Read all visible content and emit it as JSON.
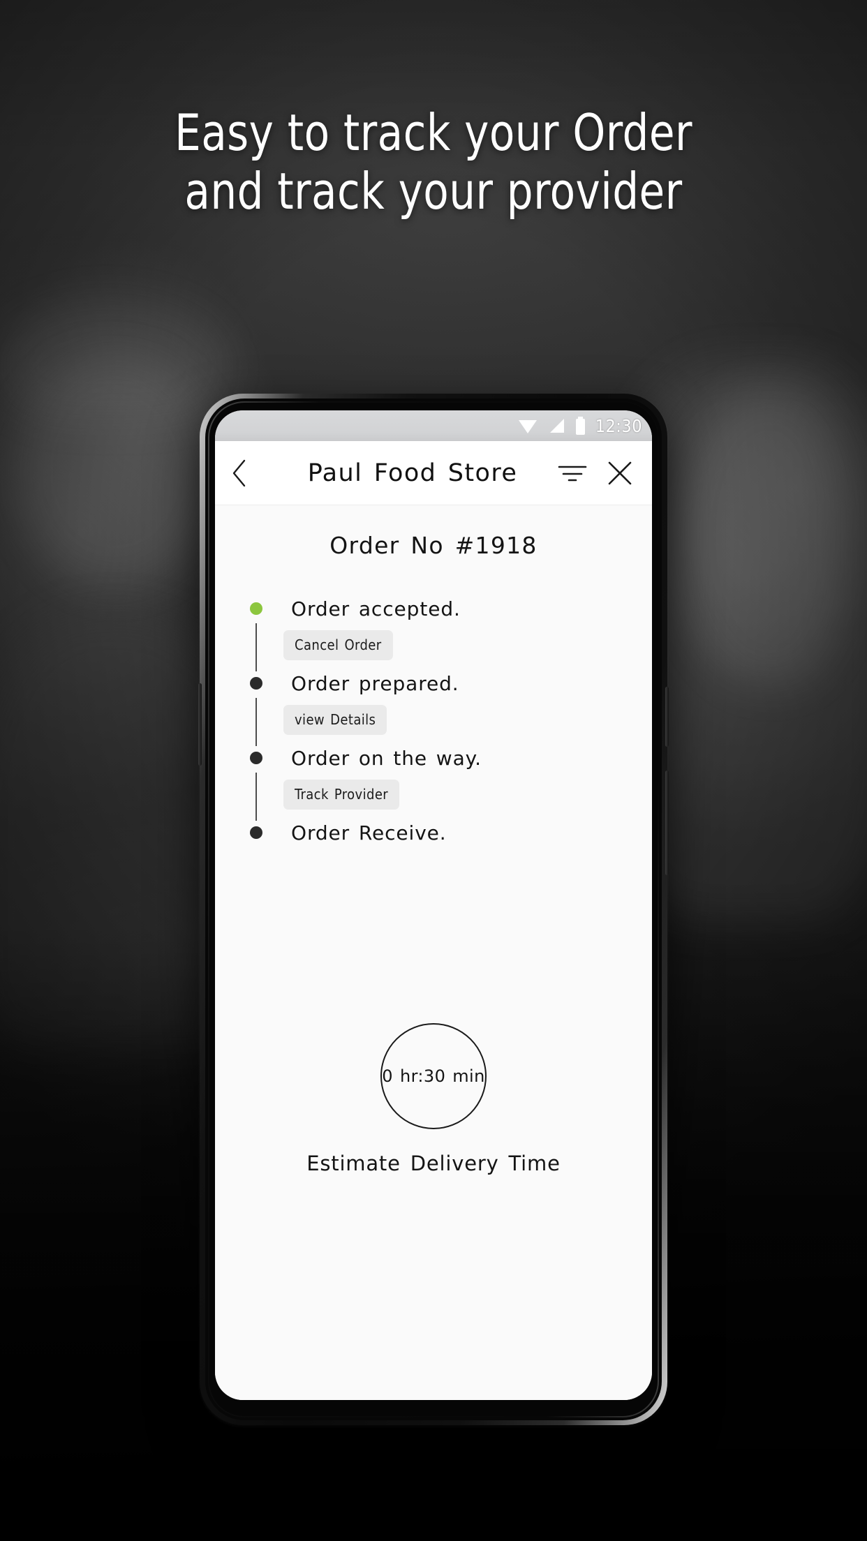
{
  "promo": {
    "headline_line1": "Easy to track your Order",
    "headline_line2": "and track your provider"
  },
  "colors": {
    "accent_green": "#8CC63E",
    "step_inactive": "#2B2B2B",
    "button_bg": "#EAEAEA",
    "screen_bg": "#FAFAFA"
  },
  "phone": {
    "status_bar": {
      "time": "12:30",
      "icons": [
        "wifi-icon",
        "signal-icon",
        "battery-icon"
      ]
    },
    "app": {
      "header": {
        "back_icon": "chevron-left-icon",
        "title": "Paul Food Store",
        "filter_icon": "filter-icon",
        "close_icon": "close-icon"
      },
      "order_number": "Order No #1918",
      "timeline": [
        {
          "label": "Order accepted.",
          "state": "active",
          "dot_color": "#8CC63E",
          "action": "Cancel Order"
        },
        {
          "label": "Order prepared.",
          "state": "pending",
          "dot_color": "#2B2B2B",
          "action": "view Details"
        },
        {
          "label": "Order on the way.",
          "state": "pending",
          "dot_color": "#2B2B2B",
          "action": "Track Provider"
        },
        {
          "label": "Order Receive.",
          "state": "pending",
          "dot_color": "#2B2B2B",
          "action": null
        }
      ],
      "estimate": {
        "value": "0 hr:30 min",
        "caption": "Estimate Delivery Time"
      }
    }
  }
}
